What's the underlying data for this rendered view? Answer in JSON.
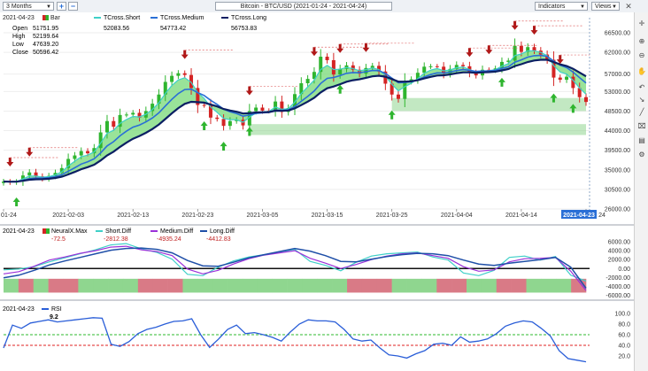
{
  "toolbar": {
    "period_select": "3 Months",
    "add_label": "+",
    "minus_label": "−",
    "chart_title": "Bitcoin - BTC/USD (2021-01-24 - 2021-04-24)",
    "indicators_label": "Indicators",
    "views_label": "Views",
    "close_label": "✕"
  },
  "price_panel": {
    "date_label": "2021-04-23",
    "bar_legend": "Bar",
    "ohlc": [
      {
        "label": "Open",
        "value": "51751.95"
      },
      {
        "label": "High",
        "value": "52199.64"
      },
      {
        "label": "Low",
        "value": "47639.20"
      },
      {
        "label": "Close",
        "value": "50596.42"
      }
    ],
    "indicators": [
      {
        "name": "TCross.Short",
        "value": "52083.56",
        "color": "#3fd0c8"
      },
      {
        "name": "TCross.Medium",
        "value": "54773.42",
        "color": "#2a6fd6"
      },
      {
        "name": "TCross.Long",
        "value": "56753.83",
        "color": "#0b1f63"
      }
    ]
  },
  "diff_panel": {
    "date_label": "2021-04-23",
    "series": [
      {
        "name": "NeuralX.Max",
        "value": "-72.5",
        "color": "#c02020"
      },
      {
        "name": "Short.Diff",
        "value": "-2812.38",
        "color": "#3fd0c8"
      },
      {
        "name": "Medium.Diff",
        "value": "-4935.24",
        "color": "#9b30d9"
      },
      {
        "name": "Long.Diff",
        "value": "-4412.83",
        "color": "#1f4fa8"
      }
    ]
  },
  "rsi_panel": {
    "date_label": "2021-04-23",
    "name": "RSI",
    "value": "9.2",
    "color": "#2a5ed8"
  },
  "colors": {
    "bull": "#2fb52f",
    "bear": "#d42424",
    "band_fill": "#7fdc7f",
    "short": "#3fd0c8",
    "medium": "#2a6fd6",
    "long": "#0b1f63",
    "zone": "#8fd68f",
    "rsi_upper": "#2db82d",
    "rsi_lower": "#e22222",
    "current_date_bg": "#2a6fd6"
  },
  "chart_data": [
    {
      "type": "candlestick",
      "title": "Bitcoin - BTC/USD (2021-01-24 - 2021-04-24)",
      "x_ticks": [
        "01-24",
        "2021-02-03",
        "2021-02-13",
        "2021-02-23",
        "2021-03-05",
        "2021-03-15",
        "2021-03-25",
        "2021-04-04",
        "2021-04-14",
        "2021-04-23"
      ],
      "x_start": "2021-01-24",
      "y_ticks": [
        66500,
        62000,
        57000,
        53000,
        48500,
        44000,
        39500,
        35000,
        30500,
        26000
      ],
      "ylim": [
        26000,
        66500
      ],
      "close_series": [
        32300,
        32100,
        32300,
        33700,
        34400,
        33500,
        33000,
        33600,
        34300,
        35400,
        37500,
        38300,
        39300,
        38800,
        40000,
        43600,
        46200,
        44900,
        47600,
        47700,
        48100,
        47000,
        48500,
        50200,
        52300,
        55200,
        56600,
        57200,
        56800,
        53800,
        49900,
        49800,
        47000,
        46700,
        45100,
        46200,
        46500,
        45200,
        48500,
        49300,
        48600,
        48500,
        50700,
        48300,
        49200,
        52400,
        54900,
        55900,
        57500,
        61000,
        60200,
        56900,
        58200,
        59000,
        58000,
        57100,
        58400,
        58900,
        57600,
        54800,
        52300,
        51300,
        55300,
        55800,
        57300,
        58700,
        58800,
        58700,
        57100,
        58200,
        59100,
        58800,
        57300,
        56700,
        58000,
        57900,
        58300,
        59800,
        60100,
        63500,
        62100,
        63200,
        62400,
        61500,
        60300,
        56200,
        55700,
        56400,
        53800,
        51700,
        50600
      ],
      "buy_signals_dates": [
        "2021-01-26",
        "2021-02-24",
        "2021-02-27",
        "2021-03-03",
        "2021-03-17",
        "2021-03-25",
        "2021-04-11",
        "2021-04-19",
        "2021-04-22"
      ],
      "sell_signals_dates": [
        "2021-01-25",
        "2021-01-28",
        "2021-02-21",
        "2021-03-03",
        "2021-03-13",
        "2021-03-17",
        "2021-03-21",
        "2021-04-06",
        "2021-04-09",
        "2021-04-13",
        "2021-04-16",
        "2021-04-20"
      ],
      "zones": [
        {
          "from": "2021-03-03",
          "to": "2021-04-24",
          "low": 43000,
          "high": 45500
        },
        {
          "from": "2021-03-25",
          "to": "2021-04-24",
          "low": 48500,
          "high": 51500
        }
      ]
    },
    {
      "type": "line",
      "title": "",
      "y_ticks": [
        6000,
        4000,
        2000,
        0,
        -2000,
        -4000,
        -6000
      ],
      "ylim": [
        -6500,
        7000
      ],
      "series": [
        {
          "name": "Short.Diff",
          "values": [
            -300,
            -100,
            400,
            1500,
            2400,
            3300,
            4200,
            5300,
            5600,
            4400,
            3600,
            2100,
            -1300,
            -1600,
            300,
            1700,
            2600,
            3100,
            3700,
            4300,
            1600,
            700,
            -500,
            1400,
            2800,
            3300,
            3500,
            3700,
            2600,
            1900,
            -1000,
            -1600,
            -400,
            2500,
            2800,
            1900,
            2700,
            -1500,
            -2812
          ]
        },
        {
          "name": "Medium.Diff",
          "values": [
            -1200,
            -700,
            500,
            1900,
            2600,
            3400,
            4000,
            4800,
            5000,
            4200,
            3800,
            2900,
            -100,
            -1200,
            -400,
            1000,
            2200,
            3000,
            3500,
            4000,
            2300,
            1200,
            0,
            900,
            2000,
            2800,
            3300,
            3500,
            2900,
            2300,
            400,
            -600,
            -300,
            1500,
            2200,
            2300,
            2500,
            -600,
            -4935
          ]
        },
        {
          "name": "Long.Diff",
          "values": [
            -2100,
            -1500,
            -400,
            800,
            1700,
            2500,
            3300,
            4100,
            4500,
            4600,
            4300,
            3500,
            1800,
            600,
            500,
            1400,
            2400,
            3100,
            3800,
            4500,
            3900,
            2900,
            1600,
            1500,
            2100,
            2700,
            3100,
            3400,
            3300,
            2900,
            1900,
            1000,
            700,
            1200,
            1600,
            2000,
            2500,
            300,
            -4412
          ]
        }
      ],
      "neural_max_blocks": [
        "green",
        "red",
        "green",
        "red",
        "red",
        "green",
        "green",
        "green",
        "green",
        "red",
        "red",
        "red",
        "green",
        "green",
        "green",
        "green",
        "green",
        "green",
        "green",
        "green",
        "green",
        "green",
        "green",
        "red",
        "red",
        "red",
        "green",
        "green",
        "green",
        "red",
        "red",
        "green",
        "green",
        "red",
        "red",
        "green",
        "green",
        "green",
        "red"
      ]
    },
    {
      "type": "line",
      "title": "",
      "y_ticks": [
        100.0,
        80.0,
        60.0,
        40.0,
        20.0
      ],
      "ylim": [
        0,
        100
      ],
      "guides": [
        60,
        40
      ],
      "series": [
        {
          "name": "RSI",
          "values": [
            35,
            78,
            72,
            82,
            85,
            88,
            84,
            86,
            88,
            90,
            92,
            91,
            42,
            38,
            47,
            62,
            70,
            74,
            80,
            85,
            86,
            90,
            60,
            36,
            52,
            70,
            78,
            62,
            64,
            60,
            55,
            48,
            65,
            80,
            88,
            86,
            86,
            84,
            70,
            52,
            48,
            50,
            35,
            22,
            20,
            16,
            24,
            30,
            42,
            44,
            40,
            56,
            46,
            48,
            52,
            62,
            76,
            82,
            86,
            84,
            72,
            58,
            30,
            15,
            12,
            9
          ]
        }
      ]
    }
  ]
}
